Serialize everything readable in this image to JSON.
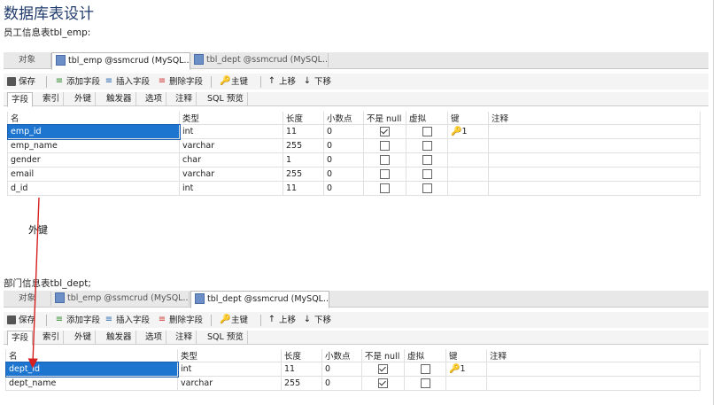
{
  "page": {
    "title": "数据库表设计",
    "emp_caption": "员工信息表tbl_emp:",
    "dept_caption": "部门信息表tbl_dept;",
    "fk_note": "外键"
  },
  "panel1": {
    "tabs": [
      "对象",
      "tbl_emp @ssmcrud (MySQL...",
      "tbl_dept @ssmcrud (MySQL..."
    ],
    "active_tab": 1
  },
  "panel2": {
    "tabs": [
      "对象",
      "tbl_emp @ssmcrud (MySQL...",
      "tbl_dept @ssmcrud (MySQL..."
    ],
    "active_tab": 2
  },
  "toolbar": {
    "save": "保存",
    "add_field": "添加字段",
    "insert_field": "插入字段",
    "delete_field": "删除字段",
    "primary_key": "主键",
    "move_up": "上移",
    "move_down": "下移"
  },
  "subtabs": [
    "字段",
    "索引",
    "外键",
    "触发器",
    "选项",
    "注释",
    "SQL 预览"
  ],
  "columns": [
    "名",
    "类型",
    "长度",
    "小数点",
    "不是 null",
    "虚拟",
    "键",
    "注释"
  ],
  "emp_fields": [
    {
      "name": "emp_id",
      "type": "int",
      "length": "11",
      "decimal": "0",
      "not_null": true,
      "virtual": false,
      "key": "1"
    },
    {
      "name": "emp_name",
      "type": "varchar",
      "length": "255",
      "decimal": "0",
      "not_null": false,
      "virtual": false,
      "key": ""
    },
    {
      "name": "gender",
      "type": "char",
      "length": "1",
      "decimal": "0",
      "not_null": false,
      "virtual": false,
      "key": ""
    },
    {
      "name": "email",
      "type": "varchar",
      "length": "255",
      "decimal": "0",
      "not_null": false,
      "virtual": false,
      "key": ""
    },
    {
      "name": "d_id",
      "type": "int",
      "length": "11",
      "decimal": "0",
      "not_null": false,
      "virtual": false,
      "key": ""
    }
  ],
  "dept_fields": [
    {
      "name": "dept_id",
      "type": "int",
      "length": "11",
      "decimal": "0",
      "not_null": true,
      "virtual": false,
      "key": "1"
    },
    {
      "name": "dept_name",
      "type": "varchar",
      "length": "255",
      "decimal": "0",
      "not_null": true,
      "virtual": false,
      "key": ""
    }
  ],
  "colors": {
    "arrow": "#d62020",
    "selection": "#1e75d0",
    "title": "#1f3a6b"
  }
}
